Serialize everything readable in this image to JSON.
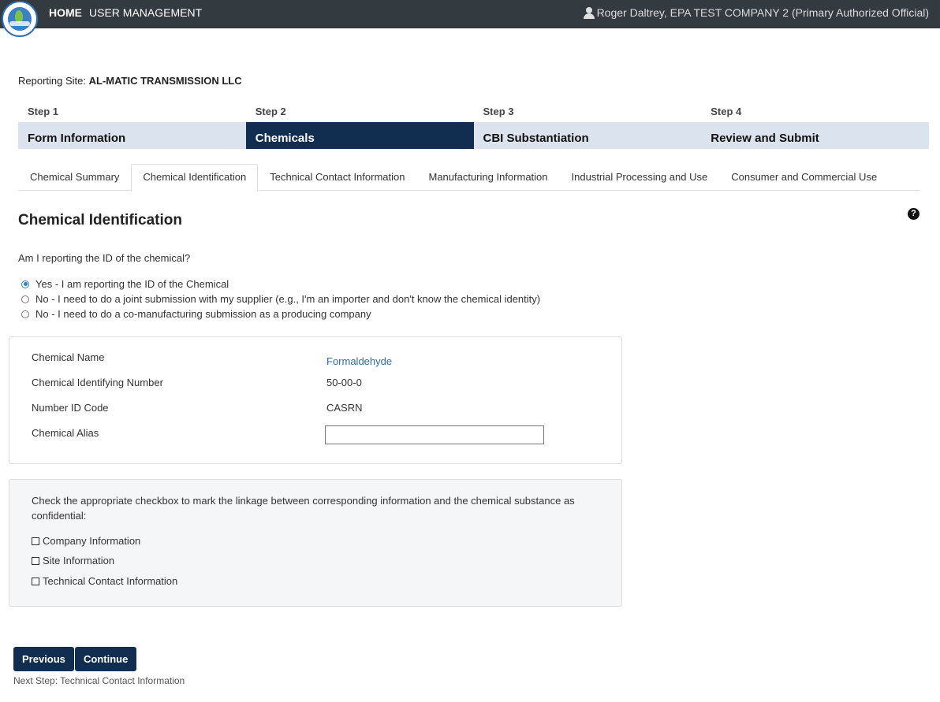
{
  "header": {
    "home_label": "HOME",
    "user_mgmt_label": "USER MANAGEMENT",
    "user_text": "Roger Daltrey, EPA TEST COMPANY 2 (Primary Authorized Official)"
  },
  "reporting_site": {
    "label": "Reporting Site:",
    "value": "AL-MATIC TRANSMISSION LLC"
  },
  "steps": [
    {
      "num": "Step 1",
      "label": "Form Information",
      "active": false
    },
    {
      "num": "Step 2",
      "label": "Chemicals",
      "active": true
    },
    {
      "num": "Step 3",
      "label": "CBI Substantiation",
      "active": false
    },
    {
      "num": "Step 4",
      "label": "Review and Submit",
      "active": false
    }
  ],
  "tabs": [
    {
      "label": "Chemical Summary",
      "active": false
    },
    {
      "label": "Chemical Identification",
      "active": true
    },
    {
      "label": "Technical Contact Information",
      "active": false
    },
    {
      "label": "Manufacturing Information",
      "active": false
    },
    {
      "label": "Industrial Processing and Use",
      "active": false
    },
    {
      "label": "Consumer and Commercial Use",
      "active": false
    }
  ],
  "section": {
    "title": "Chemical Identification",
    "question": "Am I reporting the ID of the chemical?",
    "options": [
      {
        "label": "Yes - I am reporting the ID of the Chemical",
        "checked": true
      },
      {
        "label": "No - I need to do a joint submission with my supplier (e.g., I'm an importer and don't know the chemical identity)",
        "checked": false
      },
      {
        "label": "No - I need to do a co-manufacturing submission as a producing company",
        "checked": false
      }
    ]
  },
  "chemical": {
    "name_label": "Chemical Name",
    "name_value": "Formaldehyde",
    "id_label": "Chemical Identifying Number",
    "id_value": "50-00-0",
    "code_label": "Number ID Code",
    "code_value": "CASRN",
    "alias_label": "Chemical Alias",
    "alias_value": ""
  },
  "cbi": {
    "instructions": "Check the appropriate checkbox to mark the linkage between corresponding information and the chemical substance as confidential:",
    "options": [
      {
        "label": "Company Information",
        "checked": false
      },
      {
        "label": "Site Information",
        "checked": false
      },
      {
        "label": "Technical Contact Information",
        "checked": false
      }
    ]
  },
  "footer": {
    "previous_label": "Previous",
    "continue_label": "Continue",
    "next_step": "Next Step: Technical Contact Information"
  },
  "colors": {
    "topbar": "#333a40",
    "accent": "#112e51",
    "step_inactive": "#dbe3ee",
    "link": "#2e6da4"
  }
}
